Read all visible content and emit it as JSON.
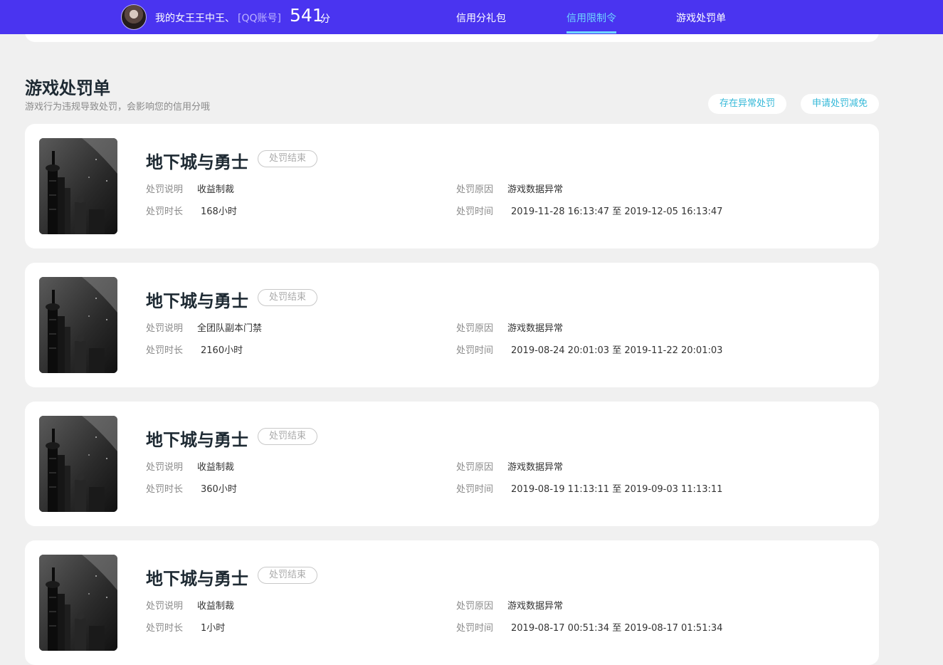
{
  "header": {
    "user_name": "我的女王王中王、",
    "account_tag": "[QQ账号]",
    "score": "541",
    "score_unit": "分",
    "nav": [
      {
        "label": "信用分礼包"
      },
      {
        "label": "信用限制令"
      },
      {
        "label": "游戏处罚单"
      }
    ],
    "active_nav": "信用限制令",
    "colors": {
      "bar": "#4a34f0",
      "active": "#6ed6ff"
    }
  },
  "section": {
    "title": "游戏处罚单",
    "subtitle": "游戏行为违规导致处罚，会影响您的信用分哦",
    "buttons": {
      "abnormal": "存在异常处罚",
      "apply": "申请处罚减免"
    }
  },
  "labels": {
    "desc": "处罚说明",
    "duration": "处罚时长",
    "reason": "处罚原因",
    "time": "处罚时间"
  },
  "records": [
    {
      "game": "地下城与勇士",
      "status": "处罚结束",
      "desc": "收益制裁",
      "duration": "168小时",
      "reason": "游戏数据异常",
      "time": "2019-11-28 16:13:47 至 2019-12-05 16:13:47"
    },
    {
      "game": "地下城与勇士",
      "status": "处罚结束",
      "desc": "全团队副本门禁",
      "duration": "2160小时",
      "reason": "游戏数据异常",
      "time": "2019-08-24 20:01:03 至 2019-11-22 20:01:03"
    },
    {
      "game": "地下城与勇士",
      "status": "处罚结束",
      "desc": "收益制裁",
      "duration": "360小时",
      "reason": "游戏数据异常",
      "time": "2019-08-19 11:13:11 至 2019-09-03 11:13:11"
    },
    {
      "game": "地下城与勇士",
      "status": "处罚结束",
      "desc": "收益制裁",
      "duration": "1小时",
      "reason": "游戏数据异常",
      "time": "2019-08-17 00:51:34 至 2019-08-17 01:51:34"
    }
  ]
}
